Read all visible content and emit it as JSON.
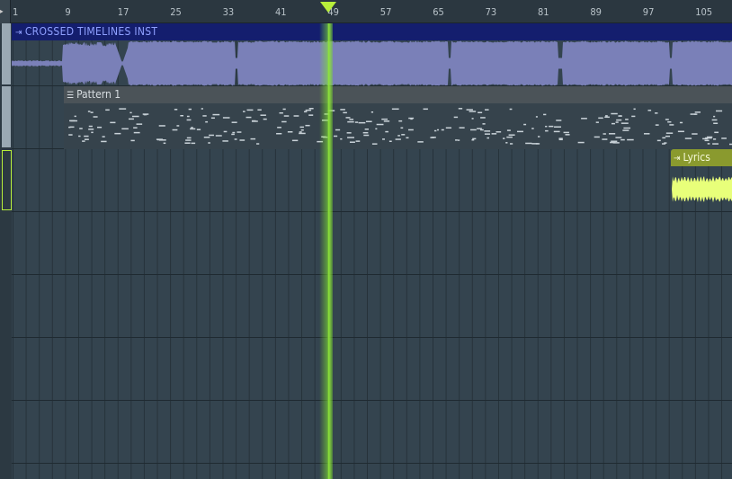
{
  "ruler": {
    "ticks": [
      "1",
      "9",
      "17",
      "25",
      "33",
      "41",
      "49",
      "57",
      "65",
      "73",
      "81",
      "89",
      "97",
      "105"
    ]
  },
  "playhead": {
    "bar": 49
  },
  "clips": {
    "instrumental": {
      "label": "CROSSED TIMELINES INST",
      "icon": "audio-clip-icon",
      "color": "#141e6e",
      "wave_color": "#7a80b8"
    },
    "pattern": {
      "label": "Pattern 1",
      "icon": "pattern-icon"
    },
    "lyrics": {
      "label": "Lyrics",
      "icon": "audio-clip-icon",
      "color": "#8a9a2e",
      "wave_color": "#e8ff7a"
    }
  },
  "colors": {
    "accent": "#b8ef3a",
    "background": "#34444f"
  }
}
